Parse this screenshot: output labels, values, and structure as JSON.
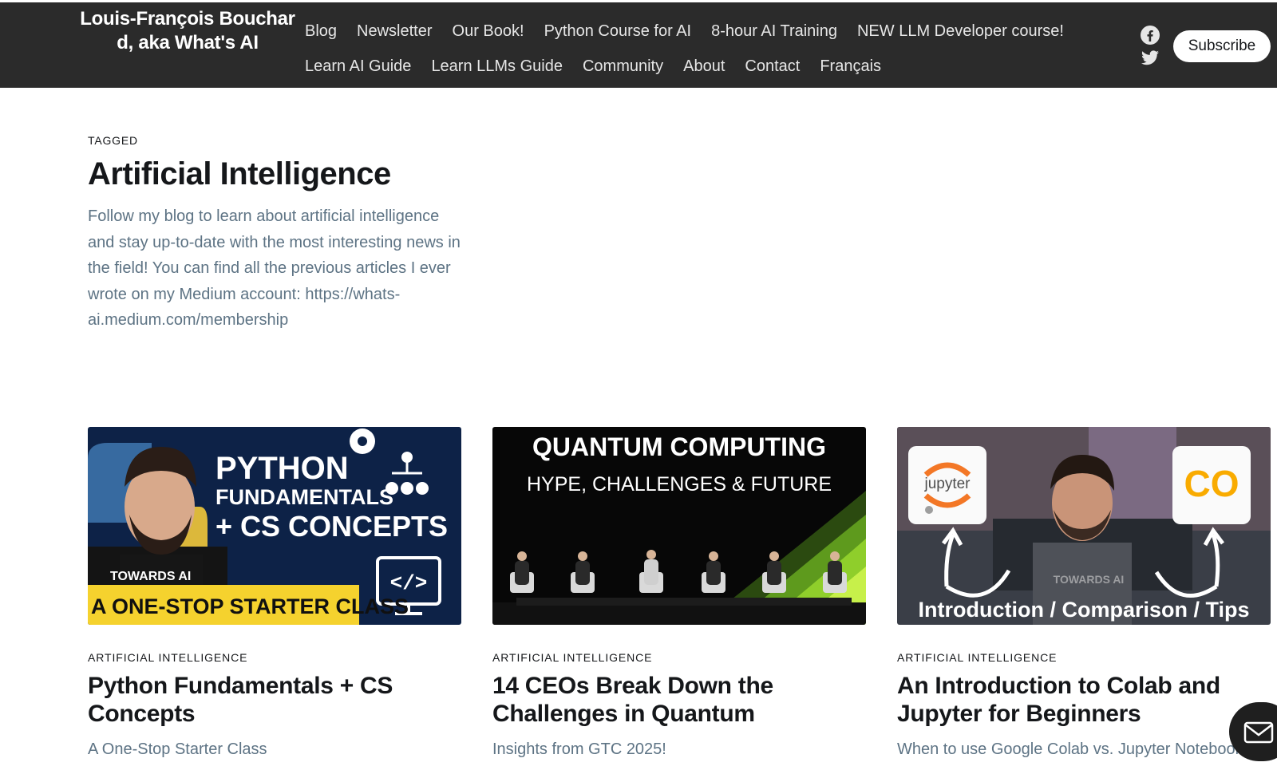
{
  "header": {
    "brand": "Louis-François Bouchard, aka What's AI",
    "nav_row1": [
      "Blog",
      "Newsletter",
      "Our Book!",
      "Python Course for AI",
      "8-hour AI Training",
      "NEW LLM Developer course!"
    ],
    "nav_row2": [
      "Learn AI Guide",
      "Learn LLMs Guide",
      "Community",
      "About",
      "Contact",
      "Français"
    ],
    "social_icons": [
      "facebook-icon",
      "twitter-icon"
    ],
    "subscribe_label": "Subscribe"
  },
  "tag": {
    "eyebrow": "TAGGED",
    "title": "Artificial Intelligence",
    "description": "Follow my blog to learn about artificial intelligence and stay up-to-date with the most interesting news in the field! You can find all the previous articles I ever wrote on my Medium account: https://whats-ai.medium.com/membership"
  },
  "posts": [
    {
      "kicker": "ARTIFICIAL INTELLIGENCE",
      "title": "Python Fundamentals + CS Concepts",
      "excerpt": "A One-Stop Starter Class",
      "thumb": {
        "line1": "PYTHON",
        "line2": "FUNDAMENTALS",
        "line3": "+ CS CONCEPTS",
        "brand": "TOWARDS AI",
        "banner": "A ONE-STOP STARTER CLASS"
      }
    },
    {
      "kicker": "ARTIFICIAL INTELLIGENCE",
      "title": "14 CEOs Break Down the Challenges in Quantum",
      "excerpt": "Insights from GTC 2025!",
      "thumb": {
        "line1": "QUANTUM COMPUTING",
        "line2": "HYPE, CHALLENGES & FUTURE"
      }
    },
    {
      "kicker": "ARTIFICIAL INTELLIGENCE",
      "title": "An Introduction to Colab and Jupyter for Beginners",
      "excerpt": "When to use Google Colab vs. Jupyter Notebook",
      "thumb": {
        "left_logo": "jupyter",
        "right_logo": "CO",
        "brand": "TOWARDS AI",
        "banner": "Introduction / Comparison / Tips"
      }
    }
  ],
  "colors": {
    "topbar": "#2b2b2b",
    "muted_text": "#5d7384",
    "yellow": "#f5d22e",
    "navy": "#0d2247"
  }
}
